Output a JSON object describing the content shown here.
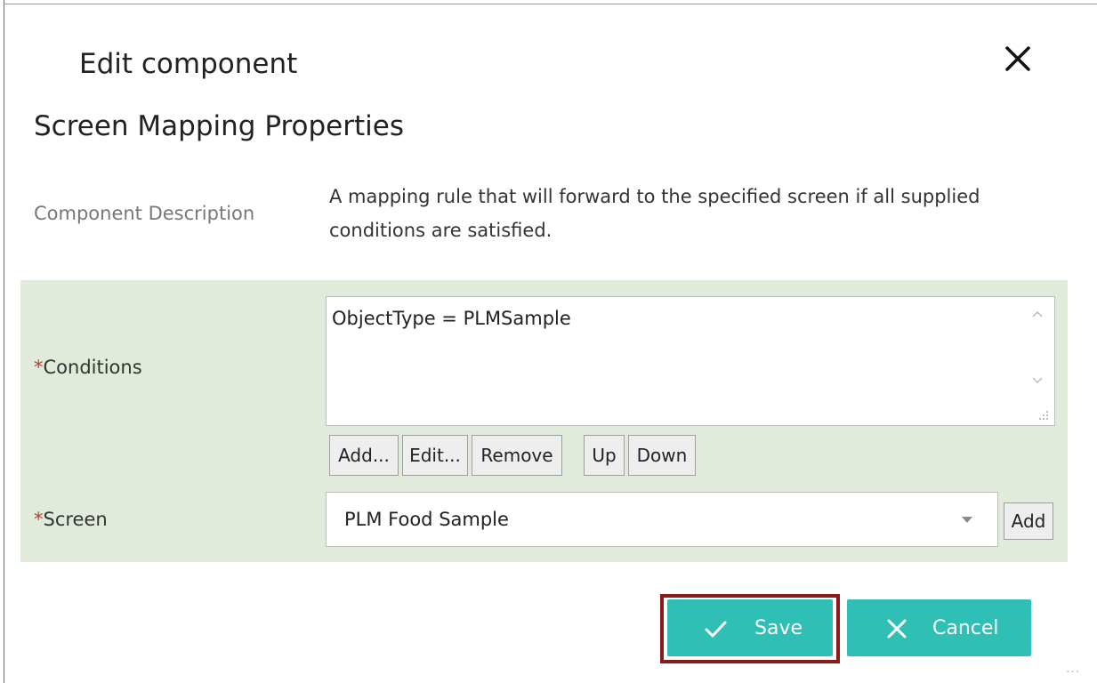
{
  "dialog": {
    "title": "Edit component",
    "section_title": "Screen Mapping Properties"
  },
  "description": {
    "label": "Component Description",
    "text": "A mapping rule that will forward to the specified screen if all supplied conditions are satisfied."
  },
  "conditions": {
    "required_marker": "*",
    "label": "Conditions",
    "value": "ObjectType = PLMSample",
    "buttons": {
      "add": "Add...",
      "edit": "Edit...",
      "remove": "Remove",
      "up": "Up",
      "down": "Down"
    }
  },
  "screen": {
    "required_marker": "*",
    "label": "Screen",
    "selected": "PLM Food Sample",
    "add_button": "Add"
  },
  "actions": {
    "save": "Save",
    "cancel": "Cancel"
  },
  "colors": {
    "accent": "#2fbfb4",
    "panel_background": "#e0ebdb",
    "highlight_border": "#8b1a1a",
    "required": "#c0392b"
  },
  "icons": {
    "close": "close-icon",
    "save": "check-icon",
    "cancel": "x-icon",
    "dropdown": "chevron-down-icon"
  }
}
